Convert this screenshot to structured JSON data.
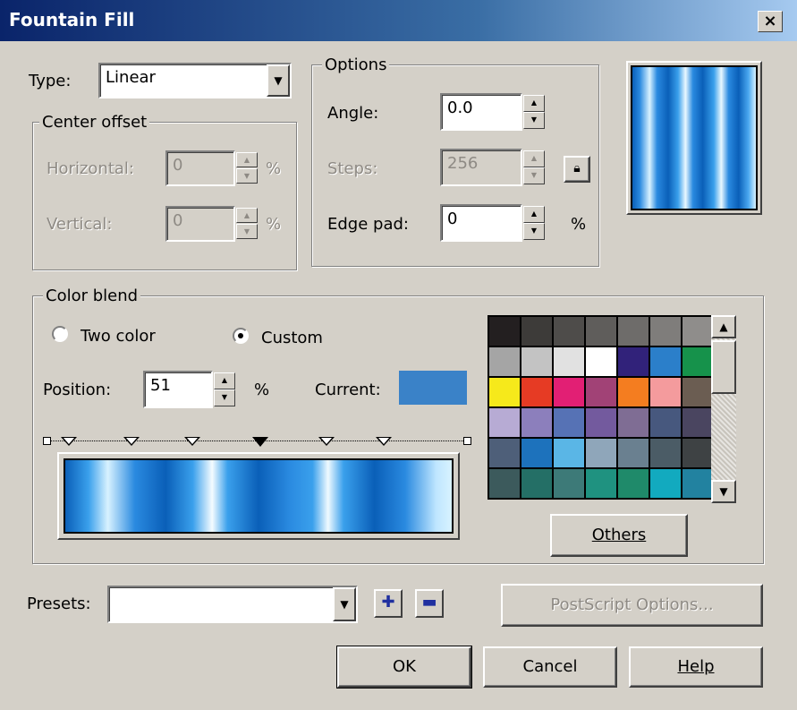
{
  "window": {
    "title": "Fountain Fill",
    "close_label": "×"
  },
  "type": {
    "label": "Type:",
    "value": "Linear"
  },
  "center_offset": {
    "legend": "Center offset",
    "horizontal_label": "Horizontal:",
    "horizontal_value": "0",
    "horizontal_unit": "%",
    "vertical_label": "Vertical:",
    "vertical_value": "0",
    "vertical_unit": "%"
  },
  "options": {
    "legend": "Options",
    "angle_label": "Angle:",
    "angle_value": "0.0",
    "steps_label": "Steps:",
    "steps_value": "256",
    "edge_pad_label": "Edge pad:",
    "edge_pad_value": "0",
    "edge_pad_unit": "%"
  },
  "color_blend": {
    "legend": "Color blend",
    "two_color_label": "Two color",
    "custom_label": "Custom",
    "selected_mode": "Custom",
    "position_label": "Position:",
    "position_value": "51",
    "position_unit": "%",
    "current_label": "Current:",
    "current_color": "#3a82c8",
    "others_label": "Others"
  },
  "palette": {
    "colors": [
      "#231f20",
      "#3d3b39",
      "#4e4c4a",
      "#5f5d5b",
      "#6e6c6a",
      "#7f7d7b",
      "#8f8d8b",
      "#a5a5a5",
      "#c3c3c3",
      "#e1e1e1",
      "#ffffff",
      "#31227a",
      "#2b7fca",
      "#16924b",
      "#f6e91b",
      "#e63b24",
      "#e21f74",
      "#a14276",
      "#f47d20",
      "#f49b9d",
      "#6b5d52",
      "#b7abd4",
      "#8c7fbc",
      "#5672b5",
      "#735a9e",
      "#7f6d94",
      "#47587e",
      "#4a4560",
      "#4e5f79",
      "#1d72bc",
      "#5ab6e6",
      "#8fa6ba",
      "#6a8090",
      "#4b5c66",
      "#3e4244",
      "#3c5a5c",
      "#246f66",
      "#3d7a78",
      "#1f9280",
      "#1f8a6a",
      "#12aabf",
      "#2282a0"
    ]
  },
  "presets": {
    "label": "Presets:",
    "value": "",
    "add_icon": "plus-icon",
    "remove_icon": "minus-icon"
  },
  "buttons": {
    "postscript_label": "PostScript Options...",
    "ok_label": "OK",
    "cancel_label": "Cancel",
    "help_label": "Help"
  }
}
